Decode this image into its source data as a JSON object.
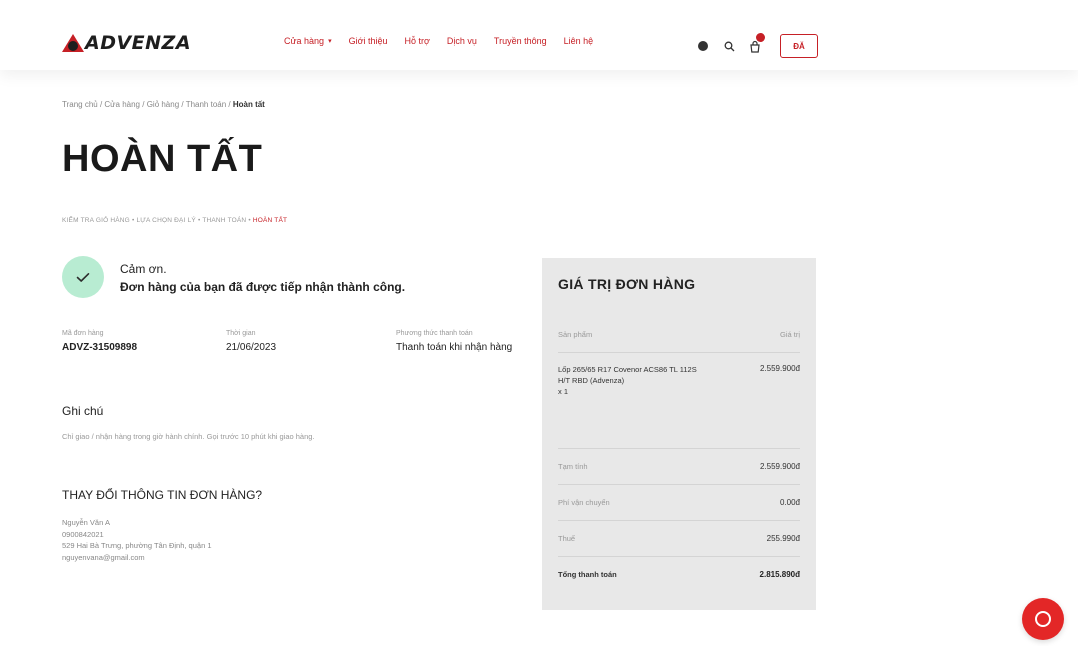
{
  "brand": {
    "logo_text": "ADVENZA",
    "accent": "#c62026",
    "success_bg": "#b8ecd2",
    "summary_bg": "#e8e8e8"
  },
  "nav": {
    "items": [
      {
        "label": "Cửa hàng",
        "has_caret": true
      },
      {
        "label": "Giới thiệu"
      },
      {
        "label": "Hỗ trợ"
      },
      {
        "label": "Dịch vụ"
      },
      {
        "label": "Truyền thông"
      },
      {
        "label": "Liên hệ"
      }
    ],
    "caret": "▾",
    "login_label": "ĐĂ"
  },
  "icons": [
    "globe-icon",
    "search-icon",
    "cart-icon",
    "check-icon",
    "chat-icon"
  ],
  "breadcrumb": {
    "items": [
      "Trang chủ",
      "Cửa hàng",
      "Giỏ hàng",
      "Thanh toán"
    ],
    "current": "Hoàn tất"
  },
  "page_title": "HOÀN TẤT",
  "steps": {
    "items": [
      "KIỂM TRA GIỎ HÀNG",
      "LỰA CHỌN ĐẠI LÝ",
      "THANH TOÁN"
    ],
    "active": "HOÀN TẤT"
  },
  "success": {
    "thanks": "Cảm ơn.",
    "message": "Đơn hàng của bạn đã được tiếp nhận thành công."
  },
  "order_info": {
    "code_label": "Mã đơn hàng",
    "code": "ADVZ-31509898",
    "time_label": "Thời gian",
    "time": "21/06/2023",
    "payment_label": "Phương thức thanh toán",
    "payment": "Thanh toán khi nhận hàng"
  },
  "note": {
    "title": "Ghi chú",
    "text": "Chỉ giao / nhận hàng trong giờ hành chính. Gọi trước 10 phút khi giao hàng."
  },
  "change_info": {
    "title": "THAY ĐỔI THÔNG TIN ĐƠN HÀNG?",
    "name": "Nguyễn Văn A",
    "phone": "0900842021",
    "address": "529 Hai Bà Trưng, phường Tân Định, quận 1",
    "email": "nguyenvana@gmail.com"
  },
  "summary": {
    "title": "GIÁ TRỊ ĐƠN HÀNG",
    "col_product": "Sản phẩm",
    "col_price": "Giá trị",
    "product": {
      "name": "Lốp 265/65 R17 Covenor ACS86 TL 112S H/T RBD (Advenza)",
      "qty": "x 1",
      "price": "2.559.900đ"
    },
    "subtotal_label": "Tạm tính",
    "subtotal": "2.559.900đ",
    "shipping_label": "Phí vận chuyển",
    "shipping": "0.00đ",
    "tax_label": "Thuế",
    "tax": "255.990đ",
    "total_label": "Tổng thanh toán",
    "total": "2.815.890đ"
  }
}
